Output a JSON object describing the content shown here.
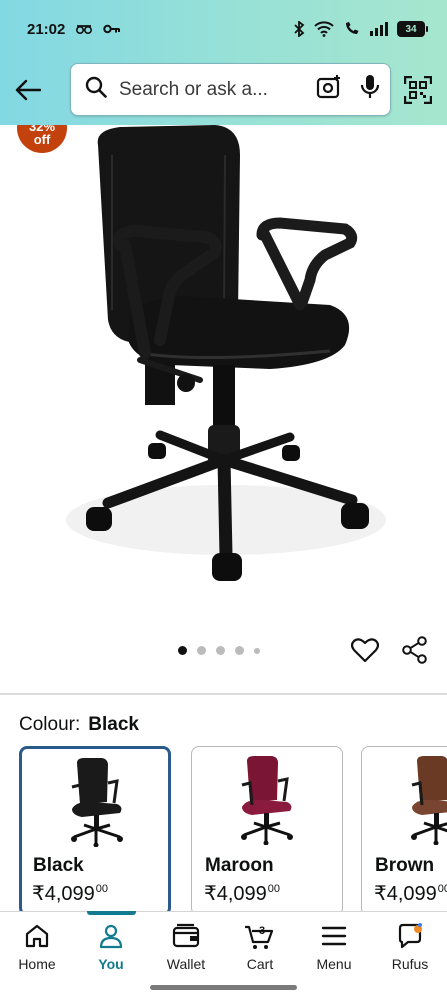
{
  "status_bar": {
    "time": "21:02",
    "battery": "34"
  },
  "header": {
    "search_placeholder": "Search or ask a..."
  },
  "product": {
    "discount_line1": "32%",
    "discount_line2": "off",
    "carousel_count": 5,
    "carousel_active": 1
  },
  "colour": {
    "label": "Colour:",
    "selected": "Black"
  },
  "variants": [
    {
      "name": "Black",
      "price": "₹4,099",
      "price_fraction": "00",
      "color": "#222222",
      "selected": true
    },
    {
      "name": "Maroon",
      "price": "₹4,099",
      "price_fraction": "00",
      "color": "#7a1535",
      "selected": false
    },
    {
      "name": "Brown",
      "price": "₹4,099",
      "price_fraction": "00",
      "color": "#6b3a24",
      "selected": false
    }
  ],
  "bottom_nav": {
    "items": [
      {
        "label": "Home",
        "icon": "home-icon",
        "active": false
      },
      {
        "label": "You",
        "icon": "person-icon",
        "active": true
      },
      {
        "label": "Wallet",
        "icon": "wallet-icon",
        "active": false
      },
      {
        "label": "Cart",
        "icon": "cart-icon",
        "badge": "3",
        "active": false
      },
      {
        "label": "Menu",
        "icon": "menu-icon",
        "active": false
      },
      {
        "label": "Rufus",
        "icon": "rufus-icon",
        "active": false
      }
    ]
  },
  "colors": {
    "accent": "#137a8f",
    "selected_border": "#2a5b8c",
    "discount": "#c2410c"
  }
}
